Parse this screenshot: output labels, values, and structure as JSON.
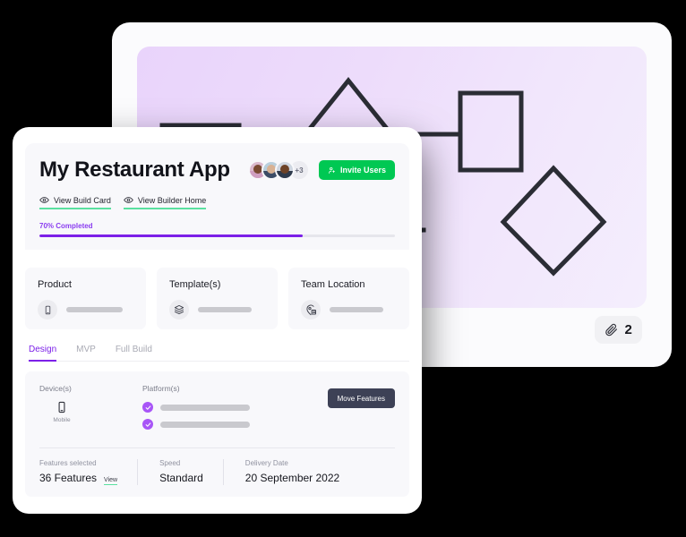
{
  "back_card": {
    "diagram": {
      "icon": "flowchart-diagram",
      "shapes": [
        "rectangle",
        "diamond",
        "rectangle",
        "diamond",
        "rectangle",
        "connector-curve",
        "connector-line"
      ]
    },
    "attachment_badge": {
      "icon": "paperclip-icon",
      "count": "2"
    }
  },
  "front_card": {
    "hero": {
      "title": "My Restaurant App",
      "avatars": [
        {
          "name": "member-1"
        },
        {
          "name": "member-2"
        },
        {
          "name": "member-3"
        }
      ],
      "avatar_overflow": "+3",
      "invite_button": {
        "label": "Invite Users",
        "icon": "user-add-icon",
        "color": "#00c853"
      },
      "links": [
        {
          "label": "View Build Card",
          "icon": "eye-icon"
        },
        {
          "label": "View Builder Home",
          "icon": "eye-icon"
        }
      ],
      "progress": {
        "label": "70% Completed",
        "percent": 70,
        "fill_width": "74%",
        "color": "#7c20e8"
      }
    },
    "summary_cards": [
      {
        "title": "Product",
        "icon": "mobile-phone-icon",
        "bar": "w1"
      },
      {
        "title": "Template(s)",
        "icon": "layers-icon",
        "bar": "w2"
      },
      {
        "title": "Team Location",
        "icon": "map-pin-building-icon",
        "bar": "w3"
      }
    ],
    "tabs": [
      {
        "label": "Design",
        "active": true
      },
      {
        "label": "MVP",
        "active": false
      },
      {
        "label": "Full Build",
        "active": false
      }
    ],
    "detail": {
      "devices": {
        "heading": "Device(s)",
        "items": [
          {
            "label": "Mobile",
            "icon": "mobile-phone-icon"
          }
        ]
      },
      "platforms": {
        "heading": "Platform(s)",
        "rows": [
          {
            "icon": "check-circle-icon",
            "state": "selected"
          },
          {
            "icon": "check-circle-icon",
            "state": "selected"
          }
        ]
      },
      "move_features_button": {
        "label": "Move Features",
        "color": "#3d4156"
      },
      "stats": [
        {
          "label": "Features selected",
          "value": "36 Features",
          "link": "View"
        },
        {
          "label": "Speed",
          "value": "Standard",
          "link": ""
        },
        {
          "label": "Delivery Date",
          "value": "20 September 2022",
          "link": ""
        }
      ]
    }
  }
}
